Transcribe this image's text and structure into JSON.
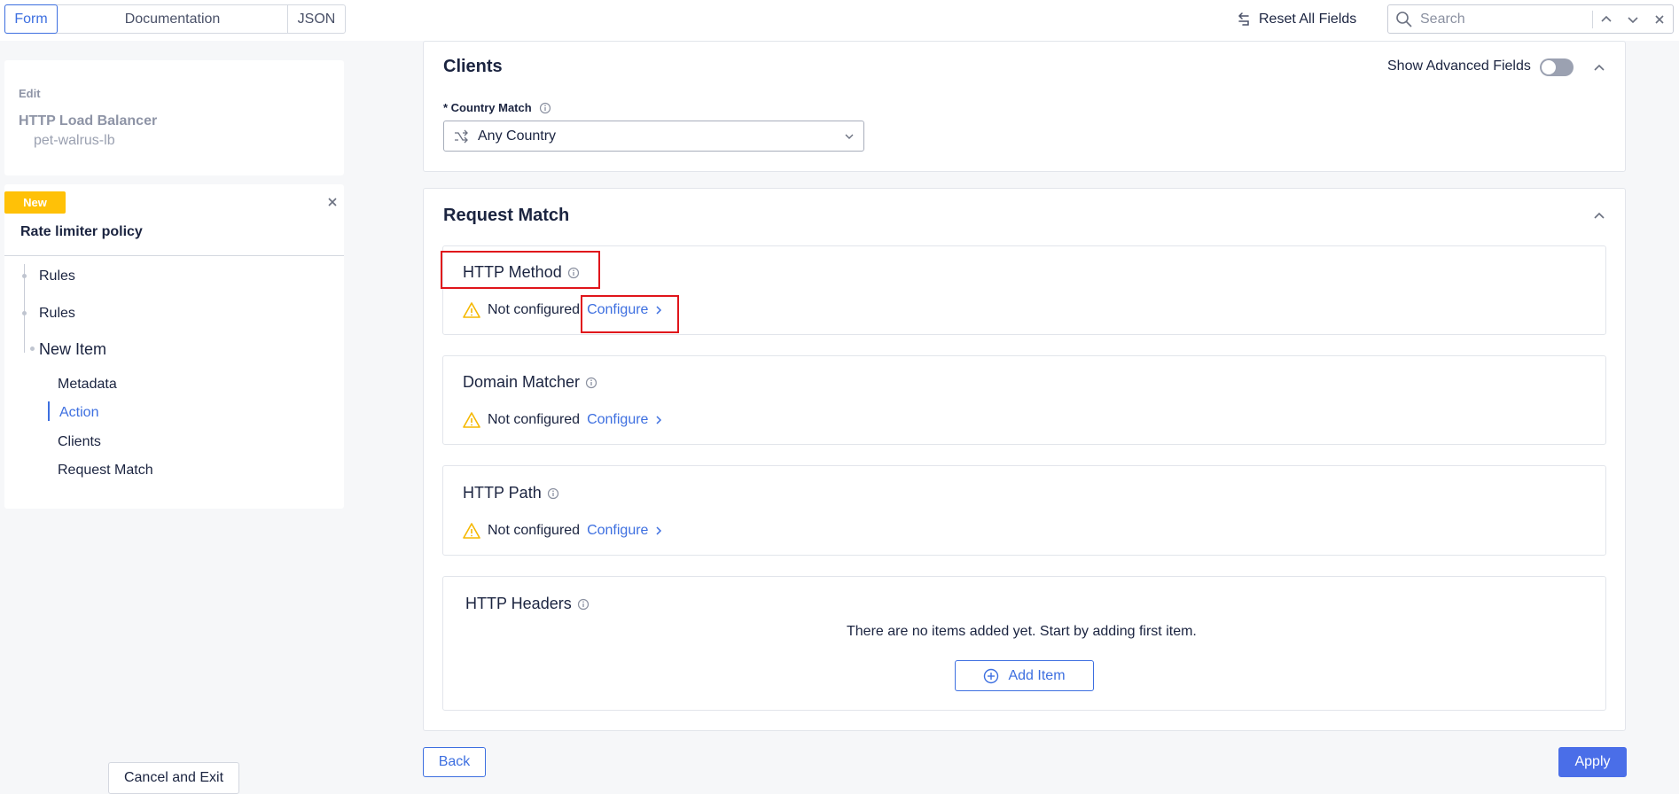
{
  "view_tabs": {
    "form": "Form",
    "documentation": "Documentation",
    "json": "JSON"
  },
  "toolbar": {
    "reset_label": "Reset All Fields",
    "search_placeholder": "Search"
  },
  "sidebar": {
    "edit_label": "Edit",
    "object_type": "HTTP Load Balancer",
    "object_name": "pet-walrus-lb",
    "badge": "New",
    "policy_title": "Rate limiter policy",
    "tree": {
      "rules_1": "Rules",
      "rules_2": "Rules",
      "new_item": "New Item",
      "children": [
        "Metadata",
        "Action",
        "Clients",
        "Request Match"
      ],
      "active_child": "Action"
    },
    "cancel_label": "Cancel and Exit"
  },
  "clients": {
    "title": "Clients",
    "advanced_fields_label": "Show Advanced Fields",
    "advanced_fields_on": false,
    "country_match_label": "* Country Match",
    "country_match_value": "Any Country"
  },
  "request_match": {
    "title": "Request Match",
    "http_method": {
      "title": "HTTP Method",
      "status": "Not configured",
      "action": "Configure"
    },
    "domain_matcher": {
      "title": "Domain Matcher",
      "status": "Not configured",
      "action": "Configure"
    },
    "http_path": {
      "title": "HTTP Path",
      "status": "Not configured",
      "action": "Configure"
    },
    "http_headers": {
      "title": "HTTP Headers",
      "empty_text": "There are no items added yet. Start by adding first item.",
      "add_label": "Add Item"
    }
  },
  "footer": {
    "back_label": "Back",
    "apply_label": "Apply"
  },
  "colors": {
    "accent": "#3d6fe0",
    "apply": "#4a6ee8",
    "badge": "#ffc107",
    "warning": "#f5b800",
    "highlight": "#e0151b"
  }
}
